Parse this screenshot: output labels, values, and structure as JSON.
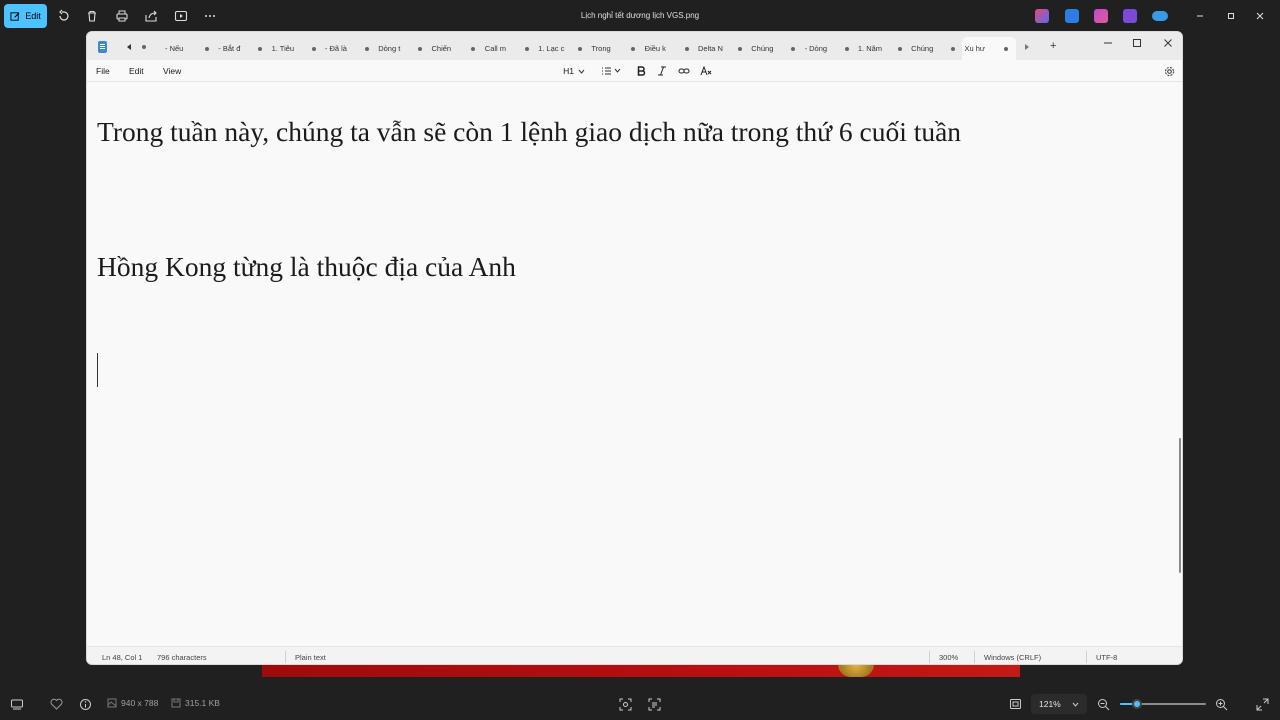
{
  "photos": {
    "edit_label": "Edit",
    "title": "Lịch nghỉ tết dương lịch VGS.png",
    "toolbar_icons": [
      "rotate-icon",
      "delete-icon",
      "print-icon",
      "share-icon",
      "slideshow-icon",
      "more-icon"
    ],
    "dimensions": "940 x 788",
    "file_size": "315.1 KB",
    "zoom": "121%",
    "zoom_fraction": 0.2
  },
  "notepad": {
    "tabs": [
      {
        "label": "- Nếu",
        "active": false
      },
      {
        "label": "- Bắt đ",
        "active": false
      },
      {
        "label": "1. Tiêu",
        "active": false
      },
      {
        "label": "- Đã là",
        "active": false
      },
      {
        "label": "Dòng t",
        "active": false
      },
      {
        "label": "Chiến",
        "active": false
      },
      {
        "label": "Call m",
        "active": false
      },
      {
        "label": "1. Lạc c",
        "active": false
      },
      {
        "label": "Trong",
        "active": false
      },
      {
        "label": "Điều k",
        "active": false
      },
      {
        "label": "Delta N",
        "active": false
      },
      {
        "label": "Chúng",
        "active": false
      },
      {
        "label": "- Dòng",
        "active": false
      },
      {
        "label": "1. Năm",
        "active": false
      },
      {
        "label": "Chúng",
        "active": false
      },
      {
        "label": "Xu hư",
        "active": true
      }
    ],
    "menu": {
      "file": "File",
      "edit": "Edit",
      "view": "View"
    },
    "format": {
      "heading": "H1"
    },
    "content": {
      "line1": "Trong tuần này, chúng ta vẫn sẽ còn 1 lệnh giao dịch nữa trong thứ 6 cuối tuần",
      "line2": "Hồng Kong từng là thuộc địa của Anh"
    },
    "status": {
      "position": "Ln 48, Col 1",
      "characters": "796 characters",
      "mode": "Plain text",
      "zoom": "300%",
      "line_ending": "Windows (CRLF)",
      "encoding": "UTF-8"
    }
  },
  "colors": {
    "accent": "#4cc2ff",
    "dark_bg": "#202020",
    "notepad_bg": "#f9f9f9"
  }
}
